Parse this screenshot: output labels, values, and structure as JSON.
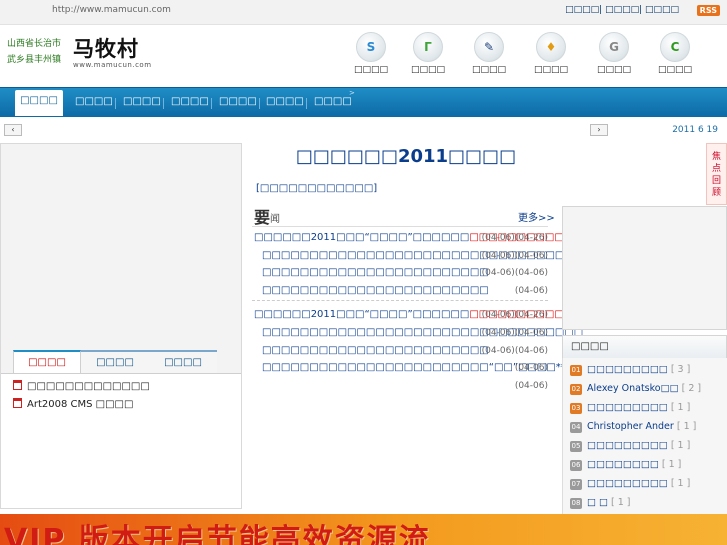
{
  "topbar": {
    "url": "http://www.mamucun.com",
    "links": "□□□□| □□□□| □□□□",
    "rss": "RSS"
  },
  "header": {
    "location_line1": "山西省长治市",
    "location_line2": "武乡县丰州镇",
    "logo_cn": "马牧村",
    "logo_en": "www.mamucun.com",
    "icons": [
      {
        "label": "□□□□",
        "glyph": "S",
        "color": "#2a8ad4",
        "icon": "s-icon"
      },
      {
        "label": "□□□□",
        "glyph": "Г",
        "color": "#3fa63a",
        "icon": "document-icon"
      },
      {
        "label": "□□□□",
        "glyph": "✎",
        "color": "#1c3f7c",
        "icon": "pen-icon"
      },
      {
        "label": "□□□□",
        "glyph": "♦",
        "color": "#e39b12",
        "icon": "flame-icon"
      },
      {
        "label": "□□□□",
        "glyph": "G",
        "color": "#888888",
        "icon": "g-icon"
      },
      {
        "label": "□□□□",
        "glyph": "C",
        "color": "#2e9b1e",
        "icon": "c-icon"
      }
    ]
  },
  "nav": {
    "active": "□□□□",
    "items": [
      "□□□□",
      "□□□□",
      "□□□□",
      "□□□□",
      "□□□□",
      "□□□□"
    ],
    "caret": ">"
  },
  "strip": {
    "left_arrow": "‹",
    "right_arrow": "›",
    "date": "2011 6 19"
  },
  "left": {
    "tabs": [
      "□□□□",
      "□□□□",
      "□□□□"
    ],
    "items": [
      "□□□□□□□□□□□□□",
      "Art2008 CMS □□□□"
    ]
  },
  "center": {
    "headline": "□□□□□□2011□□□□",
    "sublink": "[□□□□□□□□□□□□]",
    "yaowen_char": "要",
    "yaowen_label": "闻",
    "more": "更多>>",
    "news": [
      {
        "text": "□□□□□□2011□□□“□□□□”□□□□□□",
        "red": "□□□□□□□□□□□□□□",
        "date": "(04-06)(04-26)"
      },
      {
        "text": "□□□□□□□□□□□□□□□□□□□□□□□□□□□□□□□□□□",
        "red": "",
        "date": "(04-06)(04-06)"
      },
      {
        "text": "□□□□□□□□□□□□□□□□□□□□□□□□",
        "red": "",
        "date": "(04-06)(04-06)"
      },
      {
        "text": "□□□□□□□□□□□□□□□□□□□□□□□□",
        "red": "",
        "date": "(04-06)"
      },
      {
        "text": "□□□□□□2011□□□“□□□□”□□□□□□",
        "red": "□□□□□□□□□□□□□□",
        "date": "(04-06)(04-26)"
      },
      {
        "text": "□□□□□□□□□□□□□□□□□□□□□□□□□□□□□□□□□□",
        "red": "",
        "date": "(04-06)(04-06)"
      },
      {
        "text": "□□□□□□□□□□□□□□□□□□□□□□□□",
        "red": "",
        "date": "(04-06)(04-06)"
      },
      {
        "text": "□□□□□□□□□□□□□□□□□□□□□□□□“□□”□□□□***□□□□□□□□“□□”",
        "red": "",
        "date": "(04-06)"
      },
      {
        "text": "",
        "red": "",
        "date": "(04-06)"
      }
    ]
  },
  "right": {
    "focus": "焦点回顾",
    "panel_title": "□□□□",
    "ranking": [
      {
        "num": "01",
        "name": "□□□□□□□□□",
        "count": "[ 3 ]",
        "hot": true
      },
      {
        "num": "02",
        "name": "Alexey Onatsko□□",
        "count": "[ 2 ]",
        "hot": true
      },
      {
        "num": "03",
        "name": "□□□□□□□□□",
        "count": "[ 1 ]",
        "hot": true
      },
      {
        "num": "04",
        "name": "Christopher Ander",
        "count": "[ 1 ]",
        "hot": false
      },
      {
        "num": "05",
        "name": "□□□□□□□□□",
        "count": "[ 1 ]",
        "hot": false
      },
      {
        "num": "06",
        "name": "□□□□□□□□",
        "count": "[ 1 ]",
        "hot": false
      },
      {
        "num": "07",
        "name": "□□□□□□□□□",
        "count": "[ 1 ]",
        "hot": false
      },
      {
        "num": "08",
        "name": "□ □",
        "count": "[ 1 ]",
        "hot": false
      }
    ]
  },
  "banner": {
    "text": "VIP 版本开启节能高效资源流"
  }
}
